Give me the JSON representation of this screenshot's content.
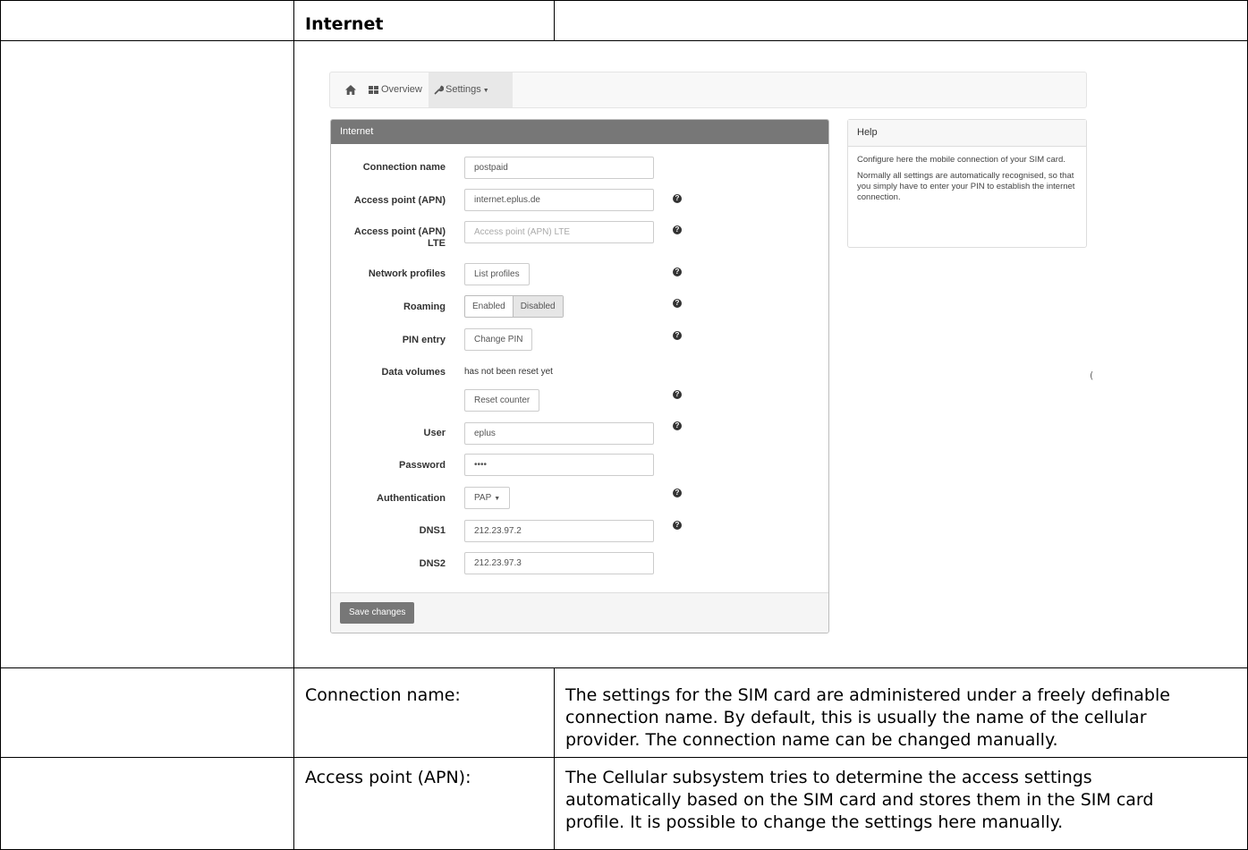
{
  "doc": {
    "header_title": "Internet",
    "rows": [
      {
        "term": "Connection name:",
        "desc_lines": [
          "The settings for the SIM card are administered under a freely definable",
          "connection name. By default, this is usually the name of the cellular",
          "provider. The connection name can be changed manually."
        ]
      },
      {
        "term": "Access point (APN):",
        "desc_lines": [
          "The Cellular subsystem tries to determine the access settings",
          "automatically based on the SIM card and stores them in the SIM card",
          "profile. It is possible to change the settings here manually."
        ]
      }
    ],
    "stray_mark": "("
  },
  "nav": {
    "overview": "Overview",
    "settings": "Settings"
  },
  "panel": {
    "title": "Internet",
    "fields": {
      "connection_name": {
        "label": "Connection name",
        "value": "postpaid"
      },
      "apn": {
        "label": "Access point (APN)",
        "value": "internet.eplus.de"
      },
      "apn_lte": {
        "label_1": "Access point (APN)",
        "label_2": "LTE",
        "placeholder": "Access point (APN) LTE"
      },
      "network_profiles": {
        "label": "Network profiles",
        "button": "List profiles"
      },
      "roaming": {
        "label": "Roaming",
        "enabled": "Enabled",
        "disabled": "Disabled"
      },
      "pin": {
        "label": "PIN entry",
        "button": "Change PIN"
      },
      "data_volumes": {
        "label": "Data volumes",
        "status": "has not been reset yet",
        "button": "Reset counter"
      },
      "user": {
        "label": "User",
        "value": "eplus"
      },
      "password": {
        "label": "Password",
        "value": "••••"
      },
      "authentication": {
        "label": "Authentication",
        "value": "PAP"
      },
      "dns1": {
        "label": "DNS1",
        "value": "212.23.97.2"
      },
      "dns2": {
        "label": "DNS2",
        "value": "212.23.97.3"
      }
    },
    "save": "Save changes"
  },
  "help": {
    "title": "Help",
    "p1": "Configure here the mobile connection of your SIM card.",
    "p2": "Normally all settings are automatically recognised, so that you simply have to enter your PIN to establish the internet connection."
  }
}
